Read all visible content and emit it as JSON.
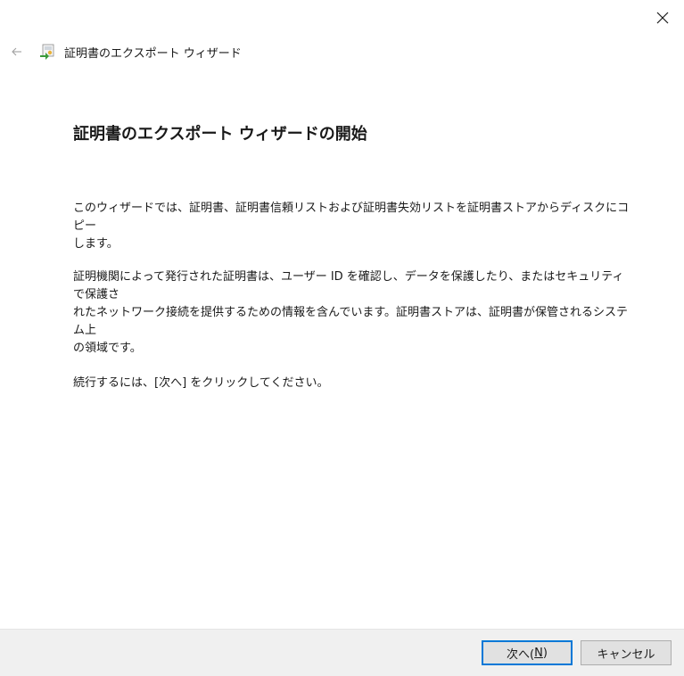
{
  "window": {
    "title": "証明書のエクスポート ウィザード"
  },
  "icons": {
    "close": "close-icon",
    "back": "back-arrow-icon",
    "wizard": "certificate-wizard-icon"
  },
  "content": {
    "heading": "証明書のエクスポート ウィザードの開始",
    "paragraph_1_line_1": "このウィザードでは、証明書、証明書信頼リストおよび証明書失効リストを証明書ストアからディスクにコピー",
    "paragraph_1_line_2": "します。",
    "paragraph_2_line_1": "証明機関によって発行された証明書は、ユーザー ID を確認し、データを保護したり、またはセキュリティで保護さ",
    "paragraph_2_line_2": "れたネットワーク接続を提供するための情報を含んでいます。証明書ストアは、証明書が保管されるシステム上",
    "paragraph_2_line_3": "の領域です。",
    "paragraph_3": "続行するには、[次へ] をクリックしてください。"
  },
  "footer": {
    "next_prefix": "次へ(",
    "next_hotkey": "N",
    "next_suffix": ")",
    "cancel_label": "キャンセル"
  },
  "colors": {
    "background": "#ffffff",
    "footer_background": "#f0f0f0",
    "button_face": "#e1e1e1",
    "default_button_border": "#0078d7"
  }
}
